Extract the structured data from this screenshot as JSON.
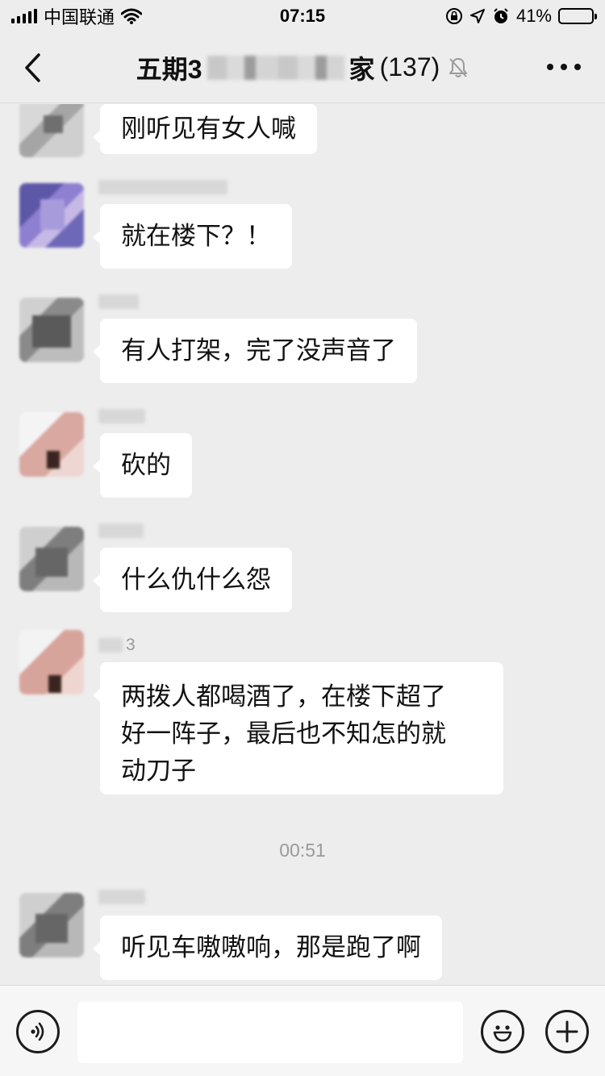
{
  "status_bar": {
    "carrier": "中国联通",
    "time": "07:15",
    "battery_percent": "41%",
    "battery_level": 0.41,
    "icons": [
      "signal-icon",
      "wifi-icon",
      "orientation-lock-icon",
      "location-icon",
      "alarm-icon",
      "battery-icon"
    ]
  },
  "nav": {
    "back_icon": "chevron-left-icon",
    "title_prefix": "五期3",
    "title_suffix": "家",
    "member_count": "(137)",
    "mute_icon": "bell-off-icon",
    "more_icon": "more-dots-icon"
  },
  "messages": [
    {
      "nick_suffix": "",
      "text": "刚听见有女人喊"
    },
    {
      "nick_suffix": "",
      "text": "就在楼下？！"
    },
    {
      "nick_suffix": "",
      "text": "有人打架，完了没声音了"
    },
    {
      "nick_suffix": "",
      "text": "砍的"
    },
    {
      "nick_suffix": "",
      "text": "什么仇什么怨"
    },
    {
      "nick_suffix": "3",
      "text": "两拨人都喝酒了，在楼下超了\n好一阵子，最后也不知怎的就\n动刀子"
    },
    {
      "nick_suffix": "",
      "text": "听见车嗷嗷响，那是跑了啊"
    }
  ],
  "timestamp": "00:51",
  "input_bar": {
    "voice_icon": "voice-icon",
    "input_value": "",
    "emoji_icon": "emoji-icon",
    "plus_icon": "plus-icon"
  }
}
